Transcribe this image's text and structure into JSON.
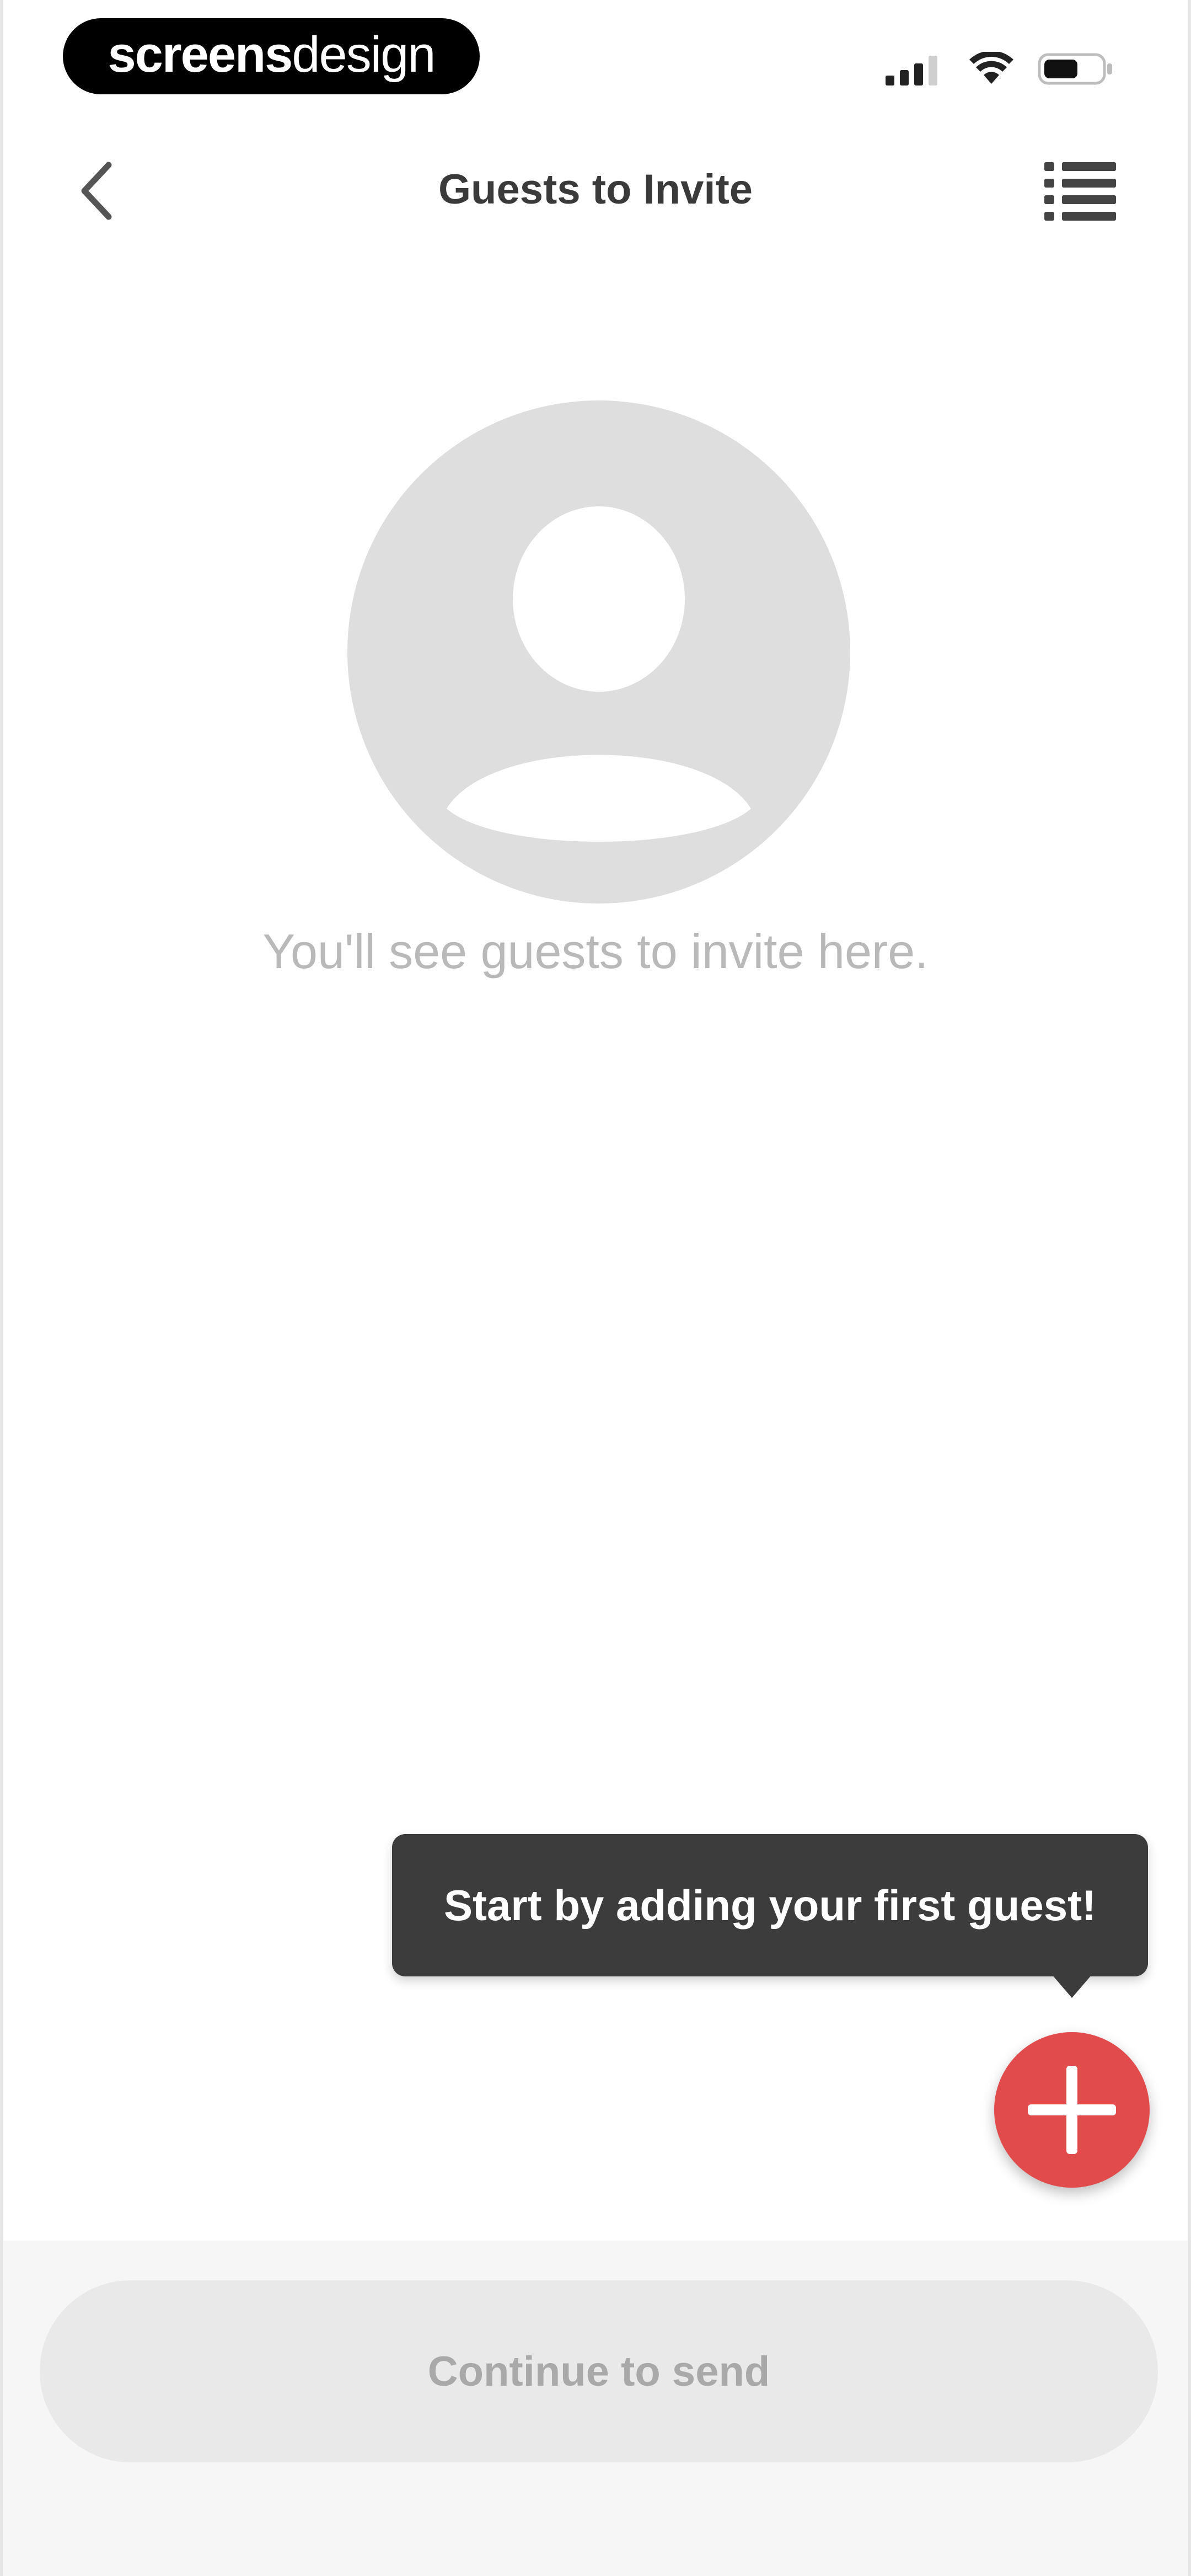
{
  "status_bar": {
    "brand_bold": "screens",
    "brand_light": "design",
    "icons": [
      "signal-icon",
      "wifi-icon",
      "battery-icon"
    ]
  },
  "nav": {
    "title": "Guests to Invite",
    "back_icon": "chevron-left-icon",
    "menu_icon": "list-icon"
  },
  "empty_state": {
    "icon": "person-placeholder-icon",
    "message": "You'll see guests to invite here."
  },
  "tooltip": {
    "text": "Start by adding your first guest!"
  },
  "fab": {
    "icon": "plus-icon",
    "color": "#e14b4b"
  },
  "footer": {
    "continue_label": "Continue to send"
  }
}
